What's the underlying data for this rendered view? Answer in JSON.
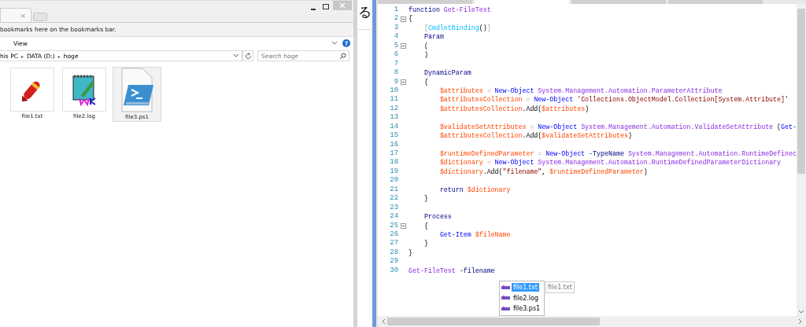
{
  "browser": {
    "tab_close": "×",
    "bookmarks_hint": "bookmarks here on the bookmarks bar."
  },
  "explorer": {
    "ribbon_tab": "View",
    "help": "?",
    "path": [
      {
        "text": "his PC"
      },
      {
        "text": "▸"
      },
      {
        "text": "DATA (D:)"
      },
      {
        "text": "▸"
      },
      {
        "text": "hoge"
      }
    ],
    "search": {
      "placeholder": "Search hoge"
    },
    "files": [
      {
        "name": "file1.txt",
        "kind": "text",
        "selected": false
      },
      {
        "name": "file2.log",
        "kind": "log",
        "selected": false
      },
      {
        "name": "file3.ps1",
        "kind": "script",
        "selected": true
      }
    ]
  },
  "background_text": "る",
  "editor": {
    "tabs": [
      {
        "selected": false
      },
      {
        "selected": true
      },
      {
        "selected": false
      },
      {
        "selected": false
      }
    ],
    "lines": [
      {
        "number": "1",
        "fold": false,
        "tokens": [
          {
            "text": "function",
            "kind": "keyword"
          },
          {
            "text": " Get-FileTest",
            "kind": "name"
          }
        ]
      },
      {
        "number": "2",
        "fold": true,
        "tokens": [
          {
            "text": "{",
            "kind": "plain"
          }
        ]
      },
      {
        "number": "3",
        "fold": false,
        "tokens": [
          {
            "text": "    [",
            "kind": "operator"
          },
          {
            "text": "CmdletBinding",
            "kind": "attribute"
          },
          {
            "text": "()",
            "kind": "plain"
          },
          {
            "text": "]",
            "kind": "operator"
          }
        ]
      },
      {
        "number": "4",
        "fold": false,
        "tokens": [
          {
            "text": "    Param",
            "kind": "keyword"
          }
        ]
      },
      {
        "number": "5",
        "fold": true,
        "tokens": [
          {
            "text": "    (",
            "kind": "plain"
          }
        ]
      },
      {
        "number": "6",
        "fold": false,
        "tokens": [
          {
            "text": "    )",
            "kind": "plain"
          }
        ]
      },
      {
        "number": "7",
        "fold": false
      },
      {
        "number": "8",
        "fold": false,
        "tokens": [
          {
            "text": "    DynamicParam",
            "kind": "keyword"
          }
        ]
      },
      {
        "number": "9",
        "fold": true,
        "tokens": [
          {
            "text": "    {",
            "kind": "plain"
          }
        ]
      },
      {
        "number": "10",
        "fold": false,
        "tokens": [
          {
            "text": "        $attributes",
            "kind": "variable"
          },
          {
            "text": " = ",
            "kind": "operator"
          },
          {
            "text": "New-Object",
            "kind": "command"
          },
          {
            "text": " System.Management.Automation.ParameterAttribute",
            "kind": "argument"
          }
        ]
      },
      {
        "number": "11",
        "fold": false,
        "tokens": [
          {
            "text": "        $attributesCollection",
            "kind": "variable"
          },
          {
            "text": " = ",
            "kind": "operator"
          },
          {
            "text": "New-Object",
            "kind": "command"
          },
          {
            "text": " 'Collections.ObjectModel.Collection[System.Attribute]'",
            "kind": "string"
          }
        ]
      },
      {
        "number": "12",
        "fold": false,
        "tokens": [
          {
            "text": "        $attributesCollection",
            "kind": "variable"
          },
          {
            "text": ".Add(",
            "kind": "plain"
          },
          {
            "text": "$attributes",
            "kind": "variable"
          },
          {
            "text": ")",
            "kind": "plain"
          }
        ]
      },
      {
        "number": "13",
        "fold": false
      },
      {
        "number": "14",
        "fold": false,
        "tokens": [
          {
            "text": "        $validateSetAttributes",
            "kind": "variable"
          },
          {
            "text": " = ",
            "kind": "operator"
          },
          {
            "text": "New-Object",
            "kind": "command"
          },
          {
            "text": " System.Management.Automation.ValidateSetAttribute",
            "kind": "argument"
          },
          {
            "text": " (",
            "kind": "plain"
          },
          {
            "text": "Get-",
            "kind": "command"
          }
        ]
      },
      {
        "number": "15",
        "fold": false,
        "tokens": [
          {
            "text": "        $attributesCollection",
            "kind": "variable"
          },
          {
            "text": ".Add(",
            "kind": "plain"
          },
          {
            "text": "$validateSetAttributes",
            "kind": "variable"
          },
          {
            "text": ")",
            "kind": "plain"
          }
        ]
      },
      {
        "number": "16",
        "fold": false
      },
      {
        "number": "17",
        "fold": false,
        "tokens": [
          {
            "text": "        $runtimeDefinedParameter",
            "kind": "variable"
          },
          {
            "text": " = ",
            "kind": "operator"
          },
          {
            "text": "New-Object",
            "kind": "command"
          },
          {
            "text": " -TypeName",
            "kind": "parameter"
          },
          {
            "text": " System.Management.Automation.RuntimeDefinec",
            "kind": "argument"
          }
        ]
      },
      {
        "number": "18",
        "fold": false,
        "tokens": [
          {
            "text": "        $dictionary",
            "kind": "variable"
          },
          {
            "text": " = ",
            "kind": "operator"
          },
          {
            "text": "New-Object",
            "kind": "command"
          },
          {
            "text": " System.Management.Automation.RuntimeDefinedParameterDictionary",
            "kind": "argument"
          }
        ]
      },
      {
        "number": "19",
        "fold": false,
        "tokens": [
          {
            "text": "        $dictionary",
            "kind": "variable"
          },
          {
            "text": ".Add(",
            "kind": "plain"
          },
          {
            "text": "\"filename\"",
            "kind": "string"
          },
          {
            "text": ", ",
            "kind": "plain"
          },
          {
            "text": "$runtimeDefinedParameter",
            "kind": "variable"
          },
          {
            "text": ")",
            "kind": "plain"
          }
        ]
      },
      {
        "number": "20",
        "fold": false
      },
      {
        "number": "21",
        "fold": false,
        "tokens": [
          {
            "text": "        return",
            "kind": "keyword"
          },
          {
            "text": " $dictionary",
            "kind": "variable"
          }
        ]
      },
      {
        "number": "22",
        "fold": false,
        "tokens": [
          {
            "text": "    }",
            "kind": "plain"
          }
        ]
      },
      {
        "number": "23",
        "fold": false
      },
      {
        "number": "24",
        "fold": false,
        "tokens": [
          {
            "text": "    Process",
            "kind": "keyword"
          }
        ]
      },
      {
        "number": "25",
        "fold": true,
        "tokens": [
          {
            "text": "    {",
            "kind": "plain"
          }
        ]
      },
      {
        "number": "26",
        "fold": false,
        "tokens": [
          {
            "text": "        Get-Item",
            "kind": "command"
          },
          {
            "text": " $fileName",
            "kind": "variable"
          }
        ]
      },
      {
        "number": "27",
        "fold": false,
        "tokens": [
          {
            "text": "    }",
            "kind": "plain"
          }
        ]
      },
      {
        "number": "28",
        "fold": false,
        "tokens": [
          {
            "text": "}",
            "kind": "plain"
          }
        ]
      },
      {
        "number": "29",
        "fold": false
      },
      {
        "number": "30",
        "fold": false,
        "tokens": [
          {
            "text": "Get-FileTest",
            "kind": "name"
          },
          {
            "text": " -filename",
            "kind": "parameter"
          }
        ]
      }
    ],
    "completion": {
      "items": [
        {
          "text": "file1.txt",
          "selected": true
        },
        {
          "text": "file2.log",
          "selected": false
        },
        {
          "text": "file3.ps1",
          "selected": false
        }
      ],
      "tooltip": "file1.txt"
    }
  }
}
